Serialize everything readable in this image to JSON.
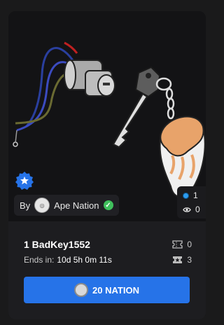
{
  "creator": {
    "prefix": "By",
    "name": "Ape Nation"
  },
  "stats": {
    "owners": "1",
    "views": "0"
  },
  "nft": {
    "title": "1 BadKey1552",
    "ends_label": "Ends in:",
    "ends_value": "10d 5h 0m 11s",
    "tickets_count": "0",
    "winners_count": "3"
  },
  "buy": {
    "label": "20 NATION"
  },
  "colors": {
    "accent": "#2673e8",
    "badge": "#2673e8",
    "verified": "#3fbf5c"
  }
}
